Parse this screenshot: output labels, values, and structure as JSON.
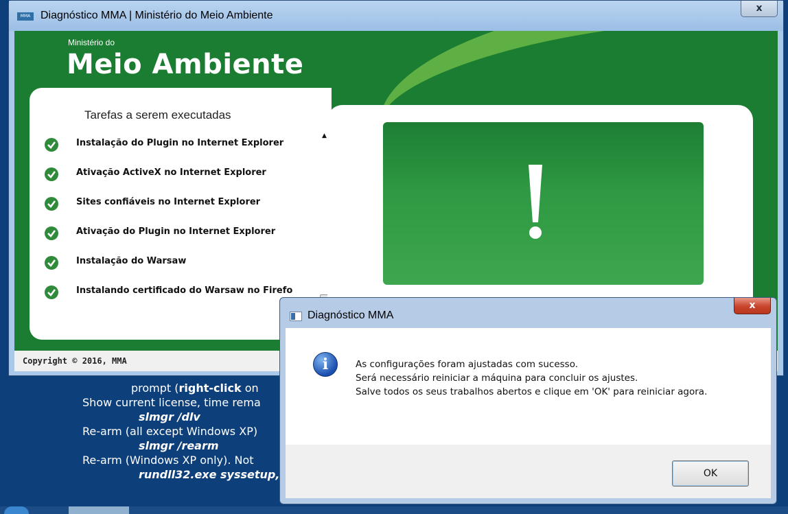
{
  "main_window": {
    "title": "Diagnóstico MMA | Ministério do Meio Ambiente",
    "app_icon_text": "MMA",
    "close_label": "x",
    "brand_small": "Ministério do",
    "brand_big": "Meio Ambiente",
    "tasks_title": "Tarefas a serem executadas",
    "tasks": [
      {
        "label": "Instalação do Plugin no Internet Explorer",
        "status": "done"
      },
      {
        "label": "Ativação ActiveX no Internet Explorer",
        "status": "done"
      },
      {
        "label": "Sites confiáveis no Internet Explorer",
        "status": "done"
      },
      {
        "label": "Ativação do Plugin no Internet Explorer",
        "status": "done"
      },
      {
        "label": "Instalação do Warsaw",
        "status": "done"
      },
      {
        "label": "Instalando certificado do Warsaw no Firefo",
        "status": "done"
      }
    ],
    "copyright": "Copyright © 2016, MMA"
  },
  "dialog": {
    "title": "Diagnóstico MMA",
    "close_label": "x",
    "message_lines": [
      "As configurações foram ajustadas com sucesso.",
      "Será necessário reiniciar a máquina para concluir os ajustes.",
      "Salve todos os seus trabalhos abertos e clique em 'OK' para reiniciar agora."
    ],
    "ok_label": "OK"
  },
  "background_text": {
    "line1_pre": "prompt (",
    "line1_bold": "right-click",
    "line1_post": " on",
    "line2": "Show current license, time rema",
    "cmd1": "slmgr /dlv",
    "line3": "Re-arm (all except Windows XP)",
    "cmd2": "slmgr /rearm",
    "line4": "Re-arm (Windows XP only). Not",
    "cmd3": "rundll32.exe syssetup,"
  },
  "colors": {
    "brand_green": "#1b7d32",
    "accent_green": "#5fb044",
    "check_green": "#2f8a3a",
    "desktop_blue": "#0d3f7a"
  }
}
